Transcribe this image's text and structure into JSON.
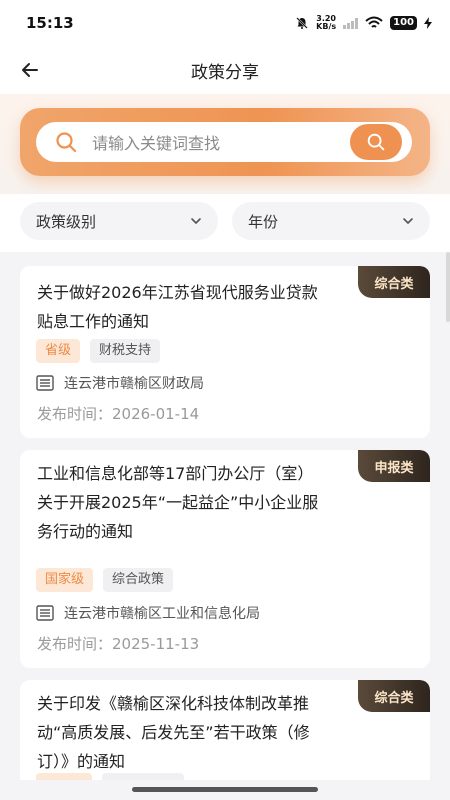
{
  "status_bar": {
    "time": "15:13",
    "net_speed_value": "3.20",
    "net_speed_unit": "KB/s",
    "battery": "100"
  },
  "header": {
    "title": "政策分享",
    "back_icon": "arrow-left-icon"
  },
  "search": {
    "placeholder": "请输入关键词查找",
    "accent_color": "#ef9150"
  },
  "filters": [
    {
      "label": "政策级别"
    },
    {
      "label": "年份"
    }
  ],
  "policies": [
    {
      "title": "关于做好2026年江苏省现代服务业贷款贴息工作的通知",
      "category": "综合类",
      "level": "省级",
      "type": "财税支持",
      "department": "连云港市赣榆区财政局",
      "date": "发布时间：2026-01-14"
    },
    {
      "title": "工业和信息化部等17部门办公厅（室）关于开展2025年“一起益企”中小企业服务行动的通知",
      "category": "申报类",
      "level": "国家级",
      "type": "综合政策",
      "department": "连云港市赣榆区工业和信息化局",
      "date": "发布时间：2025-11-13"
    },
    {
      "title": "关于印发《赣榆区深化科技体制改革推动“高质发展、后发先至”若干政策（修订）》的通知",
      "category": "综合类",
      "level": "",
      "type": "",
      "department": "",
      "date": ""
    }
  ]
}
